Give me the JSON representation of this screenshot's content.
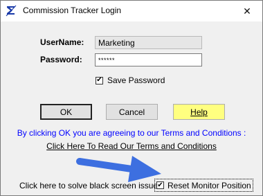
{
  "window": {
    "title": "Commission Tracker Login",
    "close_glyph": "✕"
  },
  "form": {
    "username_label": "UserName:",
    "username_value": "Marketing",
    "password_label": "Password:",
    "password_value": "******",
    "save_password_label": "Save Password",
    "save_password_checked": true
  },
  "buttons": {
    "ok": "OK",
    "cancel": "Cancel",
    "help": "Help"
  },
  "terms": {
    "notice": "By clicking OK you are agreeing to our Terms and Conditions :",
    "link": "Click Here To Read Our Terms and Conditions"
  },
  "monitor": {
    "hint": "Click here to solve black screen issues:",
    "reset_label": "Reset Monitor Position",
    "reset_checked": true
  },
  "colors": {
    "help_button": "#ffff80",
    "terms_text": "#0000ff",
    "arrow": "#3d6fe0"
  }
}
